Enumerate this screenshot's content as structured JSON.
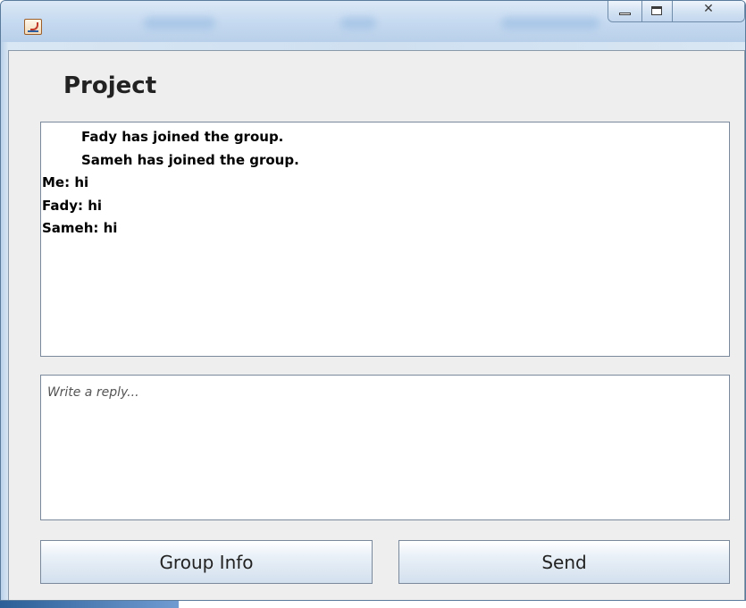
{
  "window": {
    "title_icon": "java-cup-icon",
    "caption_buttons": {
      "minimize": "minimize-icon",
      "maximize": "maximize-icon",
      "close": "close-icon",
      "close_glyph": "✕"
    }
  },
  "chat": {
    "title": "Project",
    "messages": [
      {
        "text": "Fady has joined the group.",
        "type": "system"
      },
      {
        "text": "Sameh has joined the group.",
        "type": "system"
      },
      {
        "text": "Me: hi",
        "type": "message"
      },
      {
        "text": "Fady: hi",
        "type": "message"
      },
      {
        "text": "Sameh: hi",
        "type": "message"
      }
    ]
  },
  "reply": {
    "placeholder": "Write a reply..."
  },
  "buttons": {
    "group_info": "Group Info",
    "send": "Send"
  },
  "colors": {
    "titlebar": "#c6daf0",
    "client_bg": "#eeeeee",
    "text": "#000000"
  }
}
